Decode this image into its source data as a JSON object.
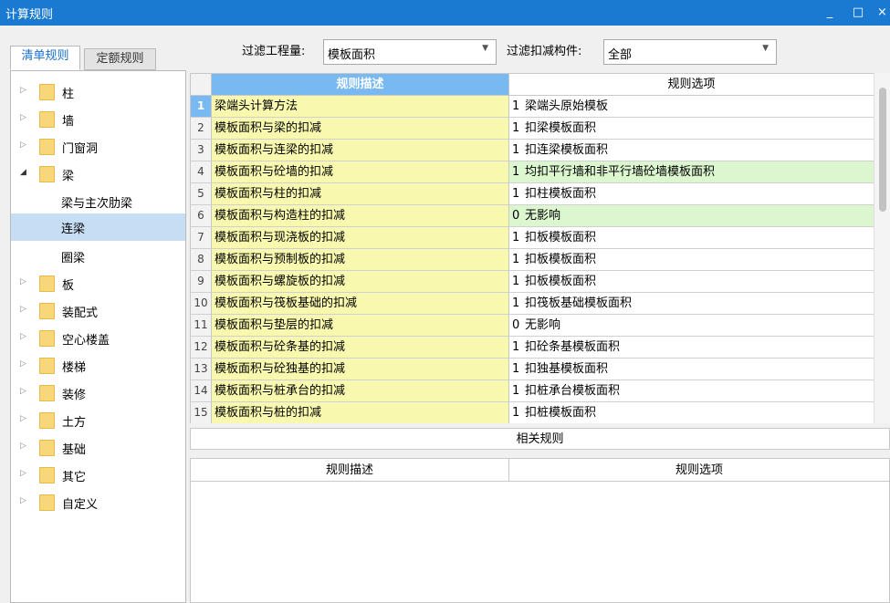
{
  "window": {
    "title": "计算规则",
    "controls": [
      "_",
      "□",
      "×"
    ]
  },
  "tabs": [
    {
      "label": "清单规则",
      "active": true
    },
    {
      "label": "定额规则",
      "active": false
    }
  ],
  "filters": {
    "quantity_label": "过滤工程量:",
    "quantity_value": "模板面积",
    "component_label": "过滤扣减构件:",
    "component_value": "全部"
  },
  "tree": {
    "items": [
      {
        "label": "柱",
        "type": "folder",
        "expand": "▷"
      },
      {
        "label": "墙",
        "type": "folder",
        "expand": "▷"
      },
      {
        "label": "门窗洞",
        "type": "folder",
        "expand": "▷"
      },
      {
        "label": "梁",
        "type": "folder",
        "expand": "◢"
      },
      {
        "label": "梁与主次肋梁",
        "type": "child"
      },
      {
        "label": "连梁",
        "type": "child",
        "selected": true
      },
      {
        "label": "圈梁",
        "type": "child"
      },
      {
        "label": "板",
        "type": "folder",
        "expand": "▷"
      },
      {
        "label": "装配式",
        "type": "folder",
        "expand": "▷"
      },
      {
        "label": "空心楼盖",
        "type": "folder",
        "expand": "▷"
      },
      {
        "label": "楼梯",
        "type": "folder",
        "expand": "▷"
      },
      {
        "label": "装修",
        "type": "folder",
        "expand": "▷"
      },
      {
        "label": "土方",
        "type": "folder",
        "expand": "▷"
      },
      {
        "label": "基础",
        "type": "folder",
        "expand": "▷"
      },
      {
        "label": "其它",
        "type": "folder",
        "expand": "▷"
      },
      {
        "label": "自定义",
        "type": "folder",
        "expand": "▷"
      }
    ]
  },
  "grid": {
    "headers": {
      "description": "规则描述",
      "option": "规则选项"
    },
    "rows": [
      {
        "num": "1",
        "desc": "梁端头计算方法",
        "opt_num": "1",
        "opt": "梁端头原始模板",
        "active": true
      },
      {
        "num": "2",
        "desc": "模板面积与梁的扣减",
        "opt_num": "1",
        "opt": "扣梁模板面积"
      },
      {
        "num": "3",
        "desc": "模板面积与连梁的扣减",
        "opt_num": "1",
        "opt": "扣连梁模板面积"
      },
      {
        "num": "4",
        "desc": "模板面积与砼墙的扣减",
        "opt_num": "1",
        "opt": "均扣平行墙和非平行墙砼墙模板面积",
        "highlight": true
      },
      {
        "num": "5",
        "desc": "模板面积与柱的扣减",
        "opt_num": "1",
        "opt": "扣柱模板面积"
      },
      {
        "num": "6",
        "desc": "模板面积与构造柱的扣减",
        "opt_num": "0",
        "opt": "无影响",
        "highlight": true
      },
      {
        "num": "7",
        "desc": "模板面积与现浇板的扣减",
        "opt_num": "1",
        "opt": "扣板模板面积"
      },
      {
        "num": "8",
        "desc": "模板面积与预制板的扣减",
        "opt_num": "1",
        "opt": "扣板模板面积"
      },
      {
        "num": "9",
        "desc": "模板面积与螺旋板的扣减",
        "opt_num": "1",
        "opt": "扣板模板面积"
      },
      {
        "num": "10",
        "desc": "模板面积与筏板基础的扣减",
        "opt_num": "1",
        "opt": "扣筏板基础模板面积"
      },
      {
        "num": "11",
        "desc": "模板面积与垫层的扣减",
        "opt_num": "0",
        "opt": "无影响"
      },
      {
        "num": "12",
        "desc": "模板面积与砼条基的扣减",
        "opt_num": "1",
        "opt": "扣砼条基模板面积"
      },
      {
        "num": "13",
        "desc": "模板面积与砼独基的扣减",
        "opt_num": "1",
        "opt": "扣独基模板面积"
      },
      {
        "num": "14",
        "desc": "模板面积与桩承台的扣减",
        "opt_num": "1",
        "opt": "扣桩承台模板面积"
      },
      {
        "num": "15",
        "desc": "模板面积与桩的扣减",
        "opt_num": "1",
        "opt": "扣桩模板面积"
      }
    ]
  },
  "related": {
    "title": "相关规则",
    "headers": {
      "description": "规则描述",
      "option": "规则选项"
    }
  },
  "colors": {
    "titlebar": "#1a7ad2",
    "header_blue": "#79b9f1",
    "desc_yellow": "#f8f9ae",
    "highlight_green": "#dcf7d0",
    "tree_selected": "#c6ddf4"
  }
}
